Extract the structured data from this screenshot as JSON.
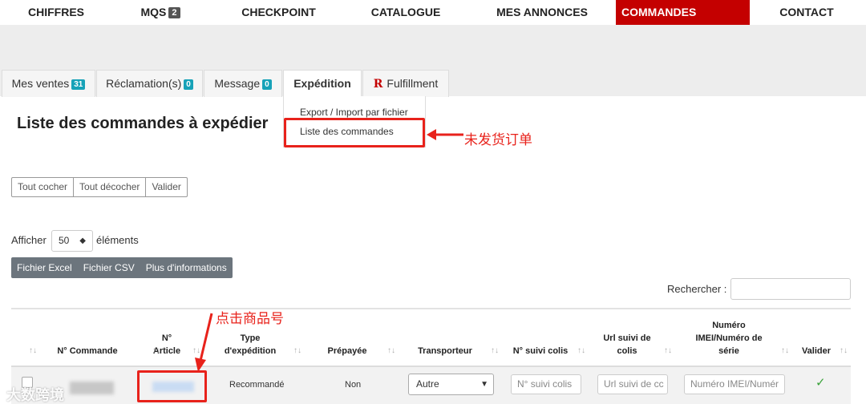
{
  "topnav": [
    {
      "label": "CHIFFRES"
    },
    {
      "label": "MQS",
      "badge": "2"
    },
    {
      "label": "CHECKPOINT"
    },
    {
      "label": "CATALOGUE"
    },
    {
      "label": "MES ANNONCES"
    },
    {
      "label": "COMMANDES",
      "active": true
    },
    {
      "label": "CONTACT"
    }
  ],
  "tabs": [
    {
      "label": "Mes ventes",
      "count": "31"
    },
    {
      "label": "Réclamation(s)",
      "count": "0"
    },
    {
      "label": "Message",
      "count": "0"
    },
    {
      "label": "Expédition",
      "active": true
    },
    {
      "label": "Fulfillment",
      "logo": "R"
    }
  ],
  "dropdown": {
    "items": [
      "Export / Import par fichier",
      "Liste des commandes"
    ]
  },
  "annotations": {
    "dropdown_note": "未发货订单",
    "article_note": "点击商品号",
    "watermark": "大数跨境"
  },
  "page_title": "Liste des commandes à expédier",
  "bulk_buttons": [
    "Tout cocher",
    "Tout décocher",
    "Valider"
  ],
  "length_menu": {
    "prefix": "Afficher",
    "value": "50",
    "suffix": "éléments"
  },
  "export_buttons": [
    "Fichier Excel",
    "Fichier CSV",
    "Plus d'informations"
  ],
  "search": {
    "label": "Rechercher :",
    "value": ""
  },
  "table": {
    "headers": {
      "order": "N° Commande",
      "article_1": "N°",
      "article_2": "Article",
      "type_1": "Type",
      "type_2": "d'expédition",
      "prepaid": "Prépayée",
      "carrier": "Transporteur",
      "tracking": "N° suivi colis",
      "url_1": "Url suivi de",
      "url_2": "colis",
      "imei_1": "Numéro",
      "imei_2": "IMEI/Numéro de",
      "imei_3": "série",
      "validate": "Valider"
    },
    "rows": [
      {
        "type": "Recommandé",
        "prepaid": "Non",
        "carrier": "Autre",
        "tracking_placeholder": "N° suivi colis",
        "url_placeholder": "Url suivi de cc",
        "imei_placeholder": "Numéro IMEI/Numér"
      }
    ]
  },
  "colors": {
    "accent": "#c40000",
    "annotation": "#e8221b",
    "badge": "#17a2b8"
  }
}
